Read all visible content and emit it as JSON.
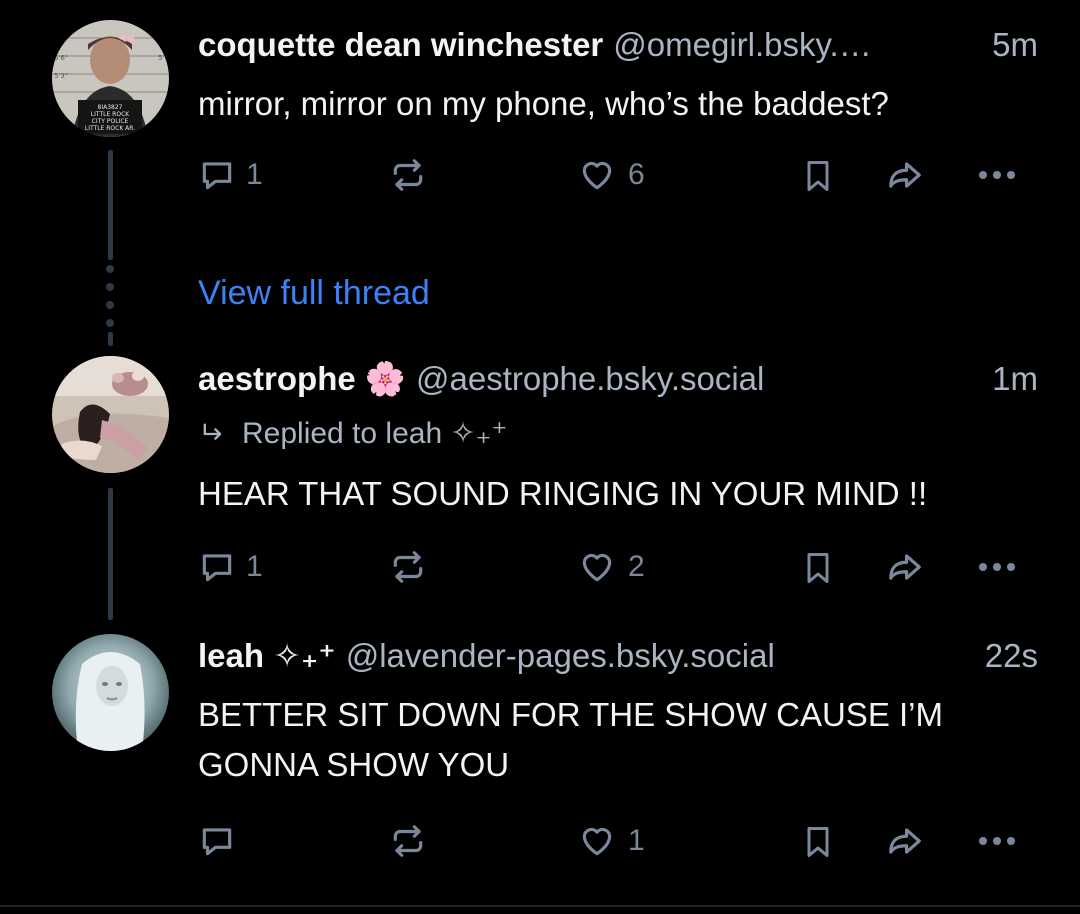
{
  "posts": [
    {
      "author_name": "coquette dean winchester",
      "handle": "@omegirl.bsky.…",
      "time": "5m",
      "text": "mirror, mirror on my phone, who’s the baddest?",
      "reply_count": "1",
      "repost_count": "",
      "like_count": "6",
      "avatar_text": [
        "8IA3827",
        "LITTLE ROCK",
        "CITY POLICE",
        "LITTLE ROCK AR."
      ],
      "avatar_height_marks": [
        "6'",
        "5'6\"",
        "5'3\"",
        "5'"
      ]
    },
    {
      "author_name": "aestrophe 🌸",
      "handle": "@aestrophe.bsky.social",
      "time": "1m",
      "reply_to_label": "Replied to leah ✧₊⁺",
      "text": "HEAR THAT SOUND RINGING IN YOUR MIND !!",
      "reply_count": "1",
      "like_count": "2"
    },
    {
      "author_name": "leah ✧₊⁺",
      "handle": "@lavender-pages.bsky.social",
      "time": "22s",
      "text": "BETTER SIT DOWN FOR THE SHOW CAUSE I’M GONNA SHOW YOU",
      "reply_count": "",
      "like_count": "1"
    }
  ],
  "view_full_thread": "View full thread",
  "icons": {
    "reply": "reply-icon",
    "repost": "repost-icon",
    "like": "heart-icon",
    "bookmark": "bookmark-icon",
    "share": "share-icon",
    "more": "more-icon"
  },
  "colors": {
    "background": "#000000",
    "text": "#f1f3f5",
    "muted": "#aab4c3",
    "icon": "#7b889b",
    "link": "#3b82f6",
    "thread_line": "#2e3847"
  }
}
